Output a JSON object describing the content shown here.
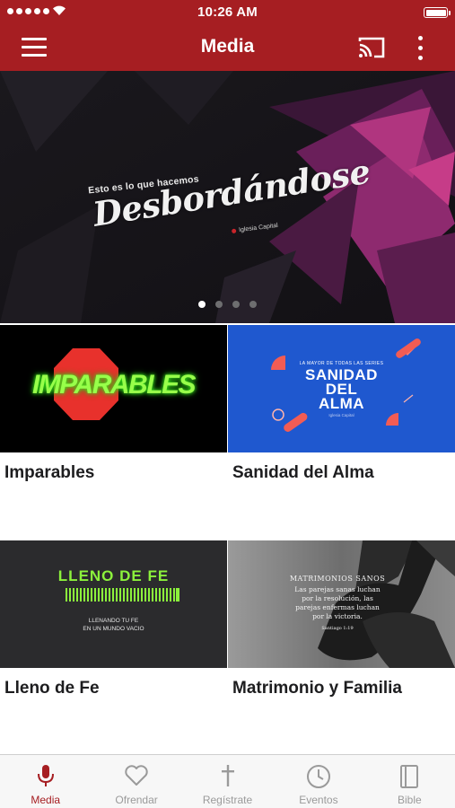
{
  "status_bar": {
    "time": "10:26 AM"
  },
  "nav": {
    "title": "Media",
    "icons": [
      "menu-icon",
      "cast-icon",
      "more-vertical-icon"
    ]
  },
  "hero": {
    "subtitle": "Esto es lo que hacemos",
    "title": "Desbordándose",
    "brand": "Iglesia Capital",
    "slides_total": 4,
    "active_slide": 1
  },
  "cards": [
    {
      "title": "Imparables",
      "thumb_text": "IMPARABLES"
    },
    {
      "title": "Sanidad del Alma",
      "thumb_small": "LA MAYOR DE TODAS LAS SERIES",
      "thumb_lines": [
        "SANIDAD",
        "DEL",
        "ALMA"
      ],
      "thumb_tag": "Iglesia Capital"
    },
    {
      "title": "Lleno de Fe",
      "thumb_title": "LLENO DE FE",
      "thumb_sub": [
        "LLENANDO TU FE",
        "EN UN MUNDO VACIO"
      ]
    },
    {
      "title": "Matrimonio y Familia",
      "thumb_heading": "MATRIMONIOS SANOS",
      "thumb_lines": [
        "Las parejas sanas luchan",
        "por la resolución, las",
        "parejas enfermas luchan",
        "por la victoria."
      ],
      "thumb_ref": "Santiago 1:19"
    }
  ],
  "tabs": [
    {
      "label": "Media",
      "icon": "microphone-icon",
      "active": true
    },
    {
      "label": "Ofrendar",
      "icon": "heart-icon",
      "active": false
    },
    {
      "label": "Regístrate",
      "icon": "cross-icon",
      "active": false
    },
    {
      "label": "Eventos",
      "icon": "clock-icon",
      "active": false
    },
    {
      "label": "Bible",
      "icon": "book-icon",
      "active": false
    }
  ],
  "colors": {
    "brand_red": "#a61e22",
    "tab_inactive": "#9a9a9a",
    "neon_green": "#8cf23c",
    "sanidad_blue": "#1f58cf"
  }
}
